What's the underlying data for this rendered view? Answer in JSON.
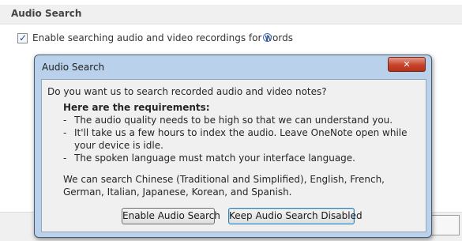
{
  "section": {
    "title": "Audio Search"
  },
  "option": {
    "label": "Enable searching audio and video recordings for words",
    "checked": true,
    "info_icon": "info-circle-icon",
    "check_glyph": "✓"
  },
  "dialog": {
    "title": "Audio Search",
    "close_glyph": "✕",
    "question": "Do you want us to search recorded audio and video notes?",
    "requirements_title": "Here are the requirements:",
    "requirements": [
      "The audio quality needs to be high so that we can understand you.",
      "It'll take us a few hours to index the audio. Leave OneNote open while your device is idle.",
      "The spoken language must match your interface language."
    ],
    "dash": "-",
    "languages_note": "We can search Chinese (Traditional and Simplified), English, French, German, Italian, Japanese, Korean, and Spanish.",
    "buttons": {
      "enable": "Enable Audio Search",
      "keep_disabled": "Keep Audio Search Disabled"
    }
  },
  "colors": {
    "dialog_frame": "#b9d1ea",
    "close_button": "#c6432a",
    "client_bg": "#f0f0f0"
  }
}
